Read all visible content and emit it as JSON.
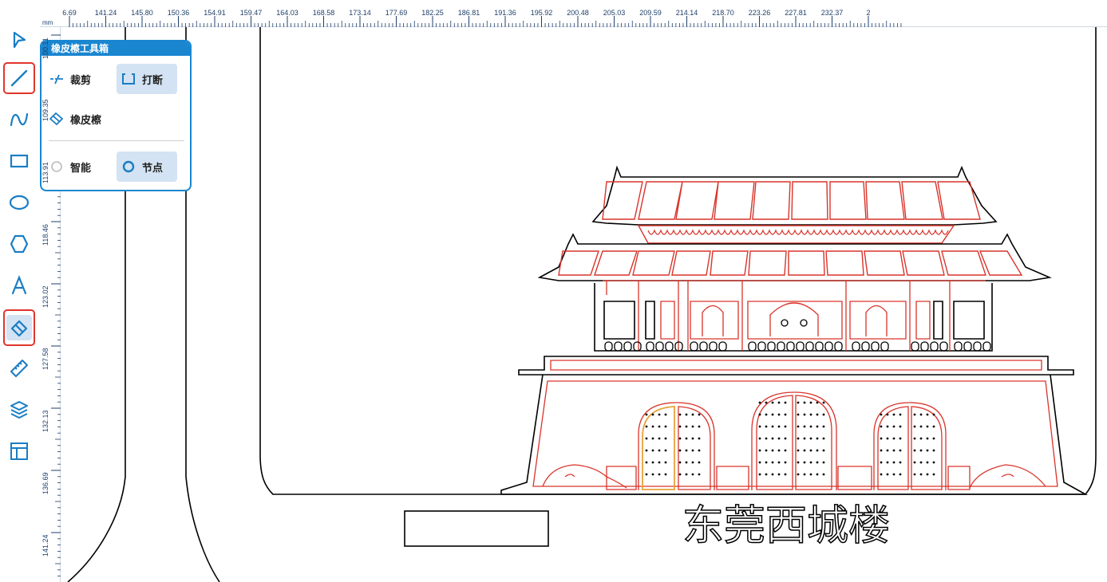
{
  "toolbar": {
    "tools": [
      {
        "name": "select-tool",
        "icon": "cursor-arrow-icon"
      },
      {
        "name": "line-tool",
        "icon": "line-icon",
        "highlighted": true
      },
      {
        "name": "curve-tool",
        "icon": "curve-icon"
      },
      {
        "name": "rectangle-tool",
        "icon": "rectangle-icon"
      },
      {
        "name": "ellipse-tool",
        "icon": "ellipse-icon"
      },
      {
        "name": "polygon-tool",
        "icon": "hexagon-icon"
      },
      {
        "name": "text-tool",
        "icon": "letter-a-icon"
      },
      {
        "name": "eraser-tool",
        "icon": "eraser-icon",
        "highlighted": true,
        "active": true
      },
      {
        "name": "measure-tool",
        "icon": "ruler-icon"
      },
      {
        "name": "layers-tool",
        "icon": "layers-icon"
      },
      {
        "name": "layout-tool",
        "icon": "layout-icon"
      }
    ],
    "highlight_color": "#e0352b",
    "icon_color": "#1a7dc4"
  },
  "ruler": {
    "unit": "mm",
    "horizontal": [
      "6.69",
      "141.24",
      "145.80",
      "150.36",
      "154.91",
      "159.47",
      "164.03",
      "168.58",
      "173.14",
      "177.69",
      "182.25",
      "186.81",
      "191.36",
      "195.92",
      "200.48",
      "205.03",
      "209.59",
      "214.14",
      "218.70",
      "223.26",
      "227.81",
      "232.37",
      "2"
    ],
    "vertical": [
      "100.11",
      "109.35",
      "113.91",
      "118.46",
      "123.02",
      "127.58",
      "132.13",
      "136.69",
      "141.24"
    ]
  },
  "eraser_panel": {
    "title": "橡皮檫工具箱",
    "cut_label": "裁剪",
    "break_label": "打断",
    "eraser_label": "橡皮檫",
    "smart_label": "智能",
    "node_label": "节点",
    "accent_color": "#1a86d0",
    "selected_bg": "#d3e3f3"
  },
  "canvas": {
    "caption": "东莞西城楼",
    "outline_color": "#000000",
    "engrave_color": "#d9342b",
    "selected_color": "#e8a33a"
  }
}
